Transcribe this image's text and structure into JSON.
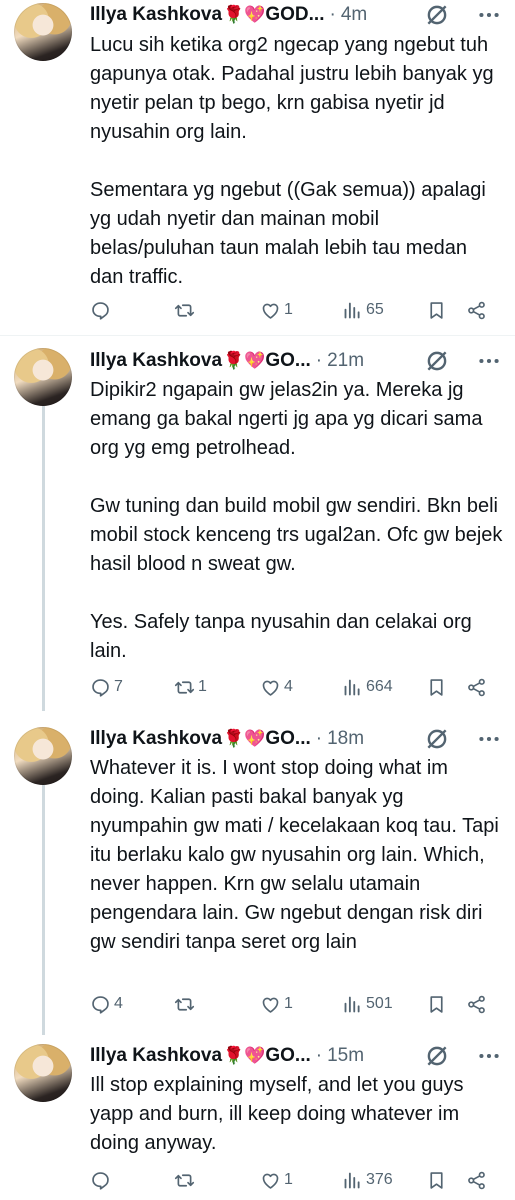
{
  "tweets": [
    {
      "author": "Illya Kashkova",
      "emoji": "🌹💖",
      "handle_trunc": "GOD...",
      "time": "4m",
      "text": "Lucu sih ketika org2 ngecap yang ngebut tuh gapunya otak. Padahal justru lebih banyak yg nyetir pelan tp bego, krn gabisa nyetir jd nyusahin org lain.\n\nSementara yg ngebut ((Gak semua)) apalagi yg udah nyetir dan mainan mobil belas/puluhan taun malah lebih tau medan dan traffic.",
      "replies": "",
      "retweets": "",
      "likes": "1",
      "views": "65"
    },
    {
      "author": "Illya Kashkova",
      "emoji": "🌹💖",
      "handle_trunc": "GO...",
      "time": "21m",
      "text": "Dipikir2 ngapain gw jelas2in ya. Mereka jg emang ga bakal ngerti jg apa yg dicari sama org yg emg petrolhead.\n\nGw tuning dan build mobil gw sendiri. Bkn beli mobil stock kenceng trs ugal2an. Ofc gw bejek hasil blood n sweat gw.\n\nYes. Safely tanpa nyusahin dan celakai org lain.",
      "replies": "7",
      "retweets": "1",
      "likes": "4",
      "views": "664"
    },
    {
      "author": "Illya Kashkova",
      "emoji": "🌹💖",
      "handle_trunc": "GO...",
      "time": "18m",
      "text": "Whatever it is. I wont stop doing what im doing. Kalian pasti bakal banyak yg nyumpahin gw mati / kecelakaan koq tau. Tapi itu berlaku kalo gw nyusahin org lain. Which, never happen. Krn gw selalu utamain pengendara lain. Gw ngebut dengan risk diri gw sendiri tanpa seret org lain",
      "replies": "4",
      "retweets": "",
      "likes": "1",
      "views": "501"
    },
    {
      "author": "Illya Kashkova",
      "emoji": "🌹💖",
      "handle_trunc": "GO...",
      "time": "15m",
      "text": "Ill stop explaining myself, and let you guys yapp and burn, ill keep doing whatever im doing anyway.",
      "replies": "",
      "retweets": "",
      "likes": "1",
      "views": "376"
    }
  ],
  "colors": {
    "text": "#0f1419",
    "muted": "#536471",
    "divider": "#eff3f4",
    "thread": "#cfd9de"
  },
  "icons": [
    "reply-icon",
    "retweet-icon",
    "like-icon",
    "views-icon",
    "bookmark-icon",
    "share-icon",
    "grok-icon",
    "more-icon"
  ]
}
